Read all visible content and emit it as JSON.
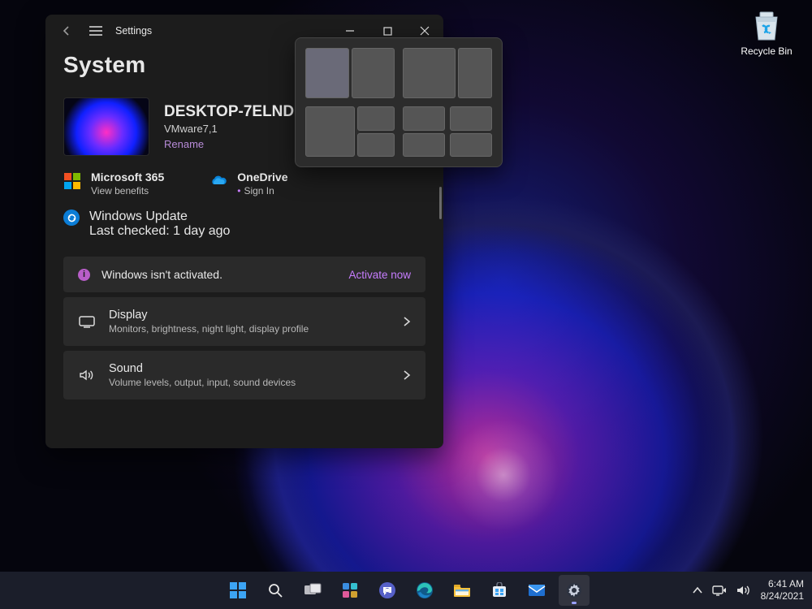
{
  "desktop": {
    "recycle_bin_label": "Recycle Bin"
  },
  "window": {
    "title": "Settings",
    "heading": "System",
    "device": {
      "name": "DESKTOP-7ELNDNI",
      "model": "VMware7,1",
      "rename": "Rename"
    },
    "services": {
      "m365": {
        "title": "Microsoft 365",
        "sub": "View benefits"
      },
      "onedrive": {
        "title": "OneDrive",
        "sub": "Sign In"
      }
    },
    "update": {
      "title": "Windows Update",
      "sub": "Last checked: 1 day ago"
    },
    "activation": {
      "text": "Windows isn't activated.",
      "link": "Activate now"
    },
    "settings": {
      "display": {
        "title": "Display",
        "desc": "Monitors, brightness, night light, display profile"
      },
      "sound": {
        "title": "Sound",
        "desc": "Volume levels, output, input, sound devices"
      }
    }
  },
  "taskbar": {
    "time": "6:41 AM",
    "date": "8/24/2021"
  }
}
